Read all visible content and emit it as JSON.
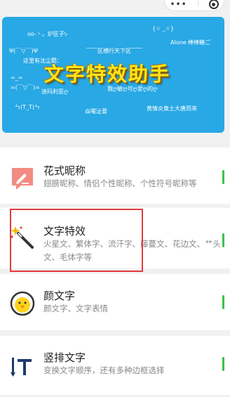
{
  "banner": {
    "lines": [
      "oo-丶。炉区子\\-",
      "{☆ _☆}",
      "Ψ(￣▽￣)Ψ",
      "Alone·棒棒糖ご",
      "﹋﹋区横行天下区﹋﹋",
      "这里有沈尘羁：",
      "=_=",
      "=(￣▽￣)=",
      "我ღ敏ღ可ღ爱ღ的ღ",
      "迪玛利亚ღ",
      "ㄣ(T_T)ㄣ",
      "焱曜沚菨",
      "黄情炎東土大唐而來"
    ],
    "title": "文字特效助手"
  },
  "features": [
    {
      "title": "花式昵称",
      "desc": "翅膀昵称、情侣个性昵称、个性符号昵称等"
    },
    {
      "title": "文字特效",
      "desc": "火星文、繁体字、流汗字、藤蔓文、花边文、艹头文、毛体字等"
    },
    {
      "title": "颜文字",
      "desc": "颜文字、文字表情"
    },
    {
      "title": "竖排文字",
      "desc": "变换文字顺序，还有多种边框选择"
    }
  ],
  "colors": {
    "banner": "#28a8e4",
    "accent_bar": "#3cc14a",
    "highlight": "#e23b3b"
  }
}
